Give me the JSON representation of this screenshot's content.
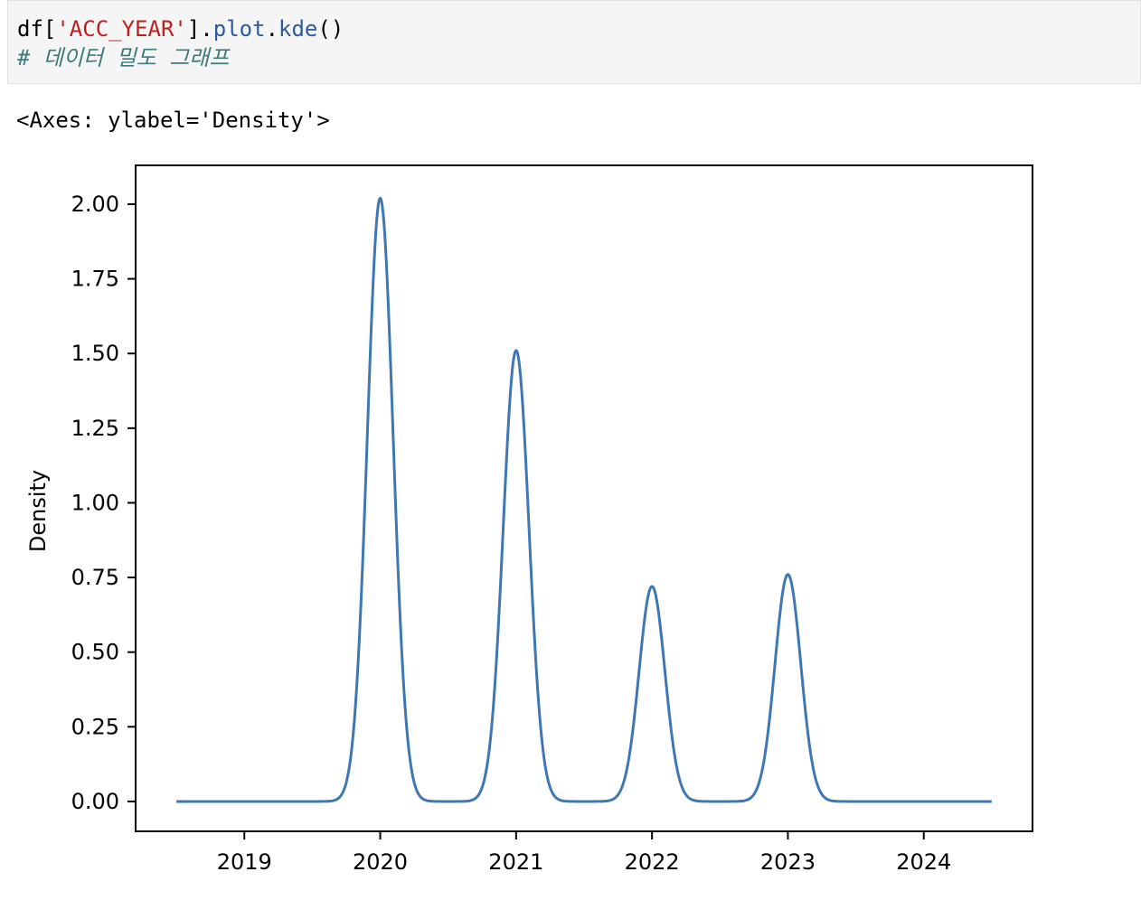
{
  "code_cell": {
    "line1": {
      "prefix": "df[",
      "string": "'ACC_YEAR'",
      "middle": "].",
      "attr1": "plot",
      "dot": ".",
      "attr2": "kde",
      "suffix": "()"
    },
    "comment": "# 데이터 밀도 그래프"
  },
  "output": {
    "repr": "<Axes: ylabel='Density'>"
  },
  "chart_data": {
    "type": "line",
    "title": "",
    "xlabel": "",
    "ylabel": "Density",
    "xlim": [
      2018.2,
      2024.8
    ],
    "ylim": [
      -0.1,
      2.13
    ],
    "x_range": [
      2018.5,
      2024.5
    ],
    "x_ticks": [
      "2019",
      "2020",
      "2021",
      "2022",
      "2023",
      "2024"
    ],
    "y_ticks": [
      "0.00",
      "0.25",
      "0.50",
      "0.75",
      "1.00",
      "1.25",
      "1.50",
      "1.75",
      "2.00"
    ],
    "line_color": "#3f77b3",
    "grid": false,
    "legend": false,
    "peaks": [
      {
        "x": 2020,
        "y": 2.02
      },
      {
        "x": 2021,
        "y": 1.51
      },
      {
        "x": 2022,
        "y": 0.72
      },
      {
        "x": 2023,
        "y": 0.76
      }
    ],
    "peak_sigma": 0.095
  }
}
